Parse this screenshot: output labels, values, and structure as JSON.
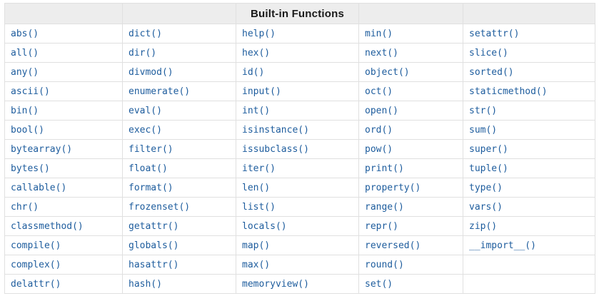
{
  "table": {
    "title": "Built-in Functions",
    "num_columns": 5,
    "rows": [
      [
        "abs()",
        "dict()",
        "help()",
        "min()",
        "setattr()"
      ],
      [
        "all()",
        "dir()",
        "hex()",
        "next()",
        "slice()"
      ],
      [
        "any()",
        "divmod()",
        "id()",
        "object()",
        "sorted()"
      ],
      [
        "ascii()",
        "enumerate()",
        "input()",
        "oct()",
        "staticmethod()"
      ],
      [
        "bin()",
        "eval()",
        "int()",
        "open()",
        "str()"
      ],
      [
        "bool()",
        "exec()",
        "isinstance()",
        "ord()",
        "sum()"
      ],
      [
        "bytearray()",
        "filter()",
        "issubclass()",
        "pow()",
        "super()"
      ],
      [
        "bytes()",
        "float()",
        "iter()",
        "print()",
        "tuple()"
      ],
      [
        "callable()",
        "format()",
        "len()",
        "property()",
        "type()"
      ],
      [
        "chr()",
        "frozenset()",
        "list()",
        "range()",
        "vars()"
      ],
      [
        "classmethod()",
        "getattr()",
        "locals()",
        "repr()",
        "zip()"
      ],
      [
        "compile()",
        "globals()",
        "map()",
        "reversed()",
        "__import__()"
      ],
      [
        "complex()",
        "hasattr()",
        "max()",
        "round()",
        ""
      ],
      [
        "delattr()",
        "hash()",
        "memoryview()",
        "set()",
        ""
      ]
    ]
  },
  "colors": {
    "link": "#1d5c9d",
    "header_bg": "#ededed",
    "border": "#e0e0e0",
    "title": "#1a1a1a"
  }
}
